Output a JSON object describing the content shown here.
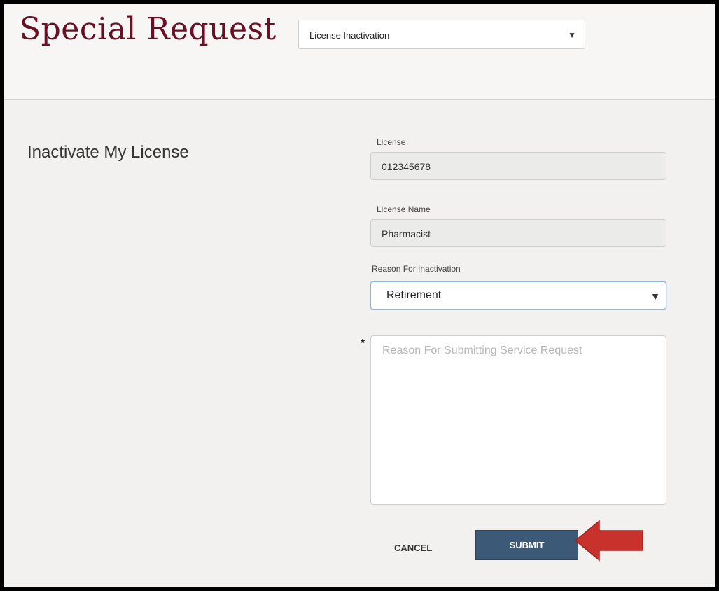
{
  "header": {
    "title": "Special Request",
    "request_type": {
      "selected": "License Inactivation"
    }
  },
  "form": {
    "section_title": "Inactivate My License",
    "license": {
      "label": "License",
      "value": "012345678"
    },
    "license_name": {
      "label": "License Name",
      "value": "Pharmacist"
    },
    "reason_for_inactivation": {
      "label": "Reason For Inactivation",
      "selected": "Retirement"
    },
    "service_request_reason": {
      "required_marker": "*",
      "placeholder": "Reason For Submitting Service Request",
      "value": ""
    }
  },
  "actions": {
    "cancel_label": "CANCEL",
    "submit_label": "SUBMIT"
  },
  "icons": {
    "dropdown": "chevron-down-icon",
    "annotation": "arrow-left-icon"
  },
  "colors": {
    "title": "#6a1024",
    "submit_button": "#3c5a78",
    "annotation_arrow": "#c8312c",
    "focus_border": "#8fb3dc"
  }
}
